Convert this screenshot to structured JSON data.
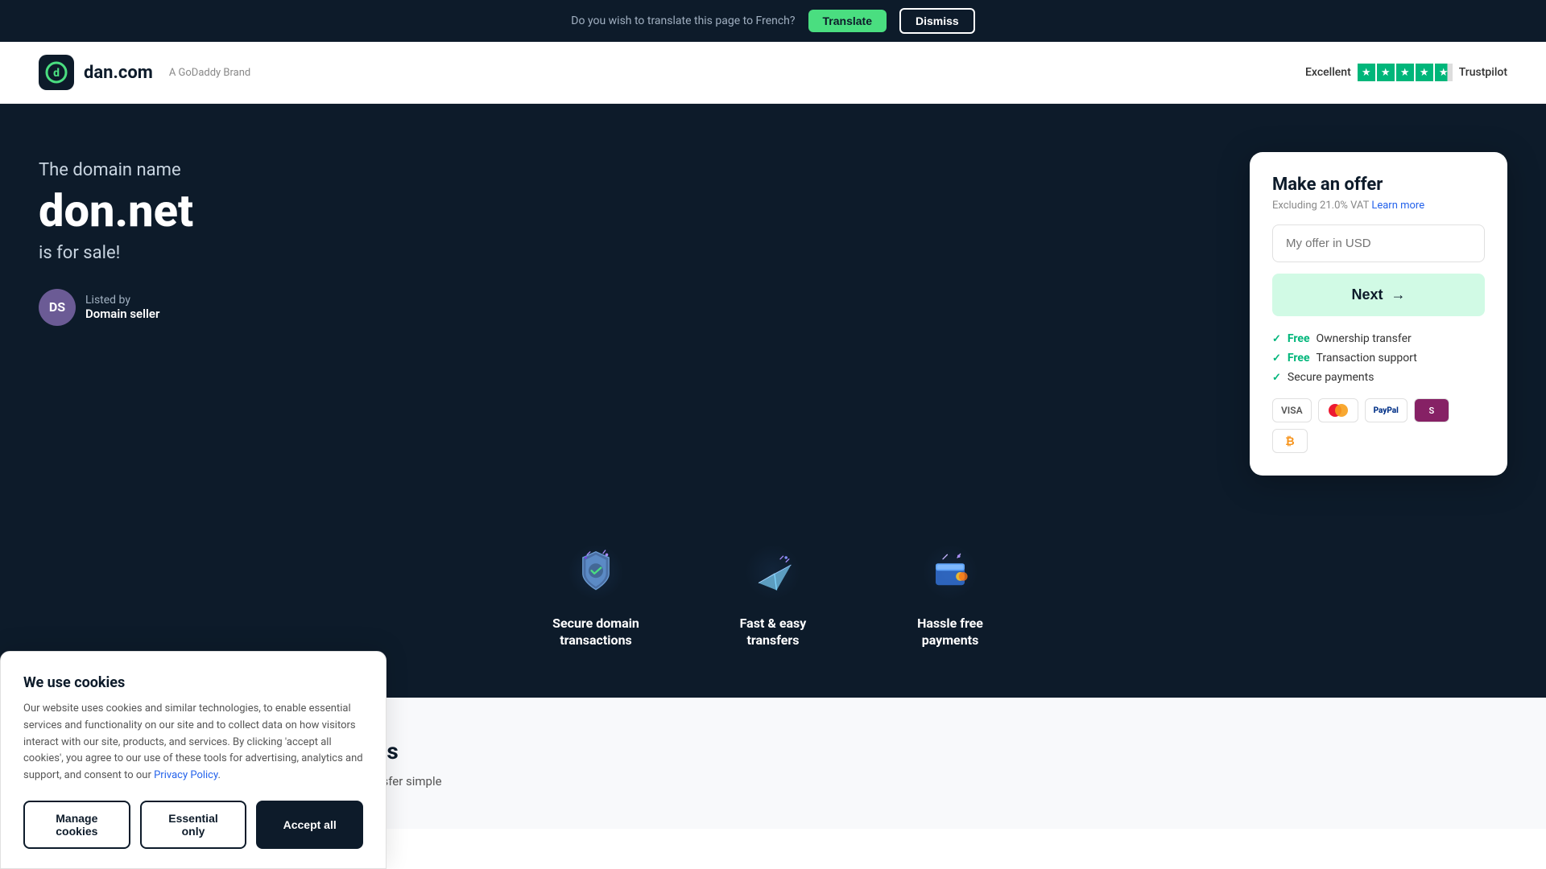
{
  "translate_bar": {
    "message": "Do you wish to translate this page to French?",
    "translate_btn": "Translate",
    "dismiss_btn": "Dismiss"
  },
  "header": {
    "logo_icon": "d",
    "logo_text": "dan.com",
    "logo_brand": "A GoDaddy Brand",
    "trustpilot_label": "Excellent",
    "trustpilot_name": "Trustpilot"
  },
  "hero": {
    "subtitle": "The domain name",
    "domain": "don.net",
    "forsale": "is for sale!",
    "listed_by_label": "Listed by",
    "listed_by_name": "Domain seller",
    "avatar_initials": "DS"
  },
  "offer_card": {
    "title": "Make an offer",
    "vat_text": "Excluding 21.0% VAT",
    "learn_more": "Learn more",
    "input_placeholder": "My offer in USD",
    "next_btn": "Next",
    "benefits": [
      {
        "label": "Ownership transfer",
        "free": true
      },
      {
        "label": "Transaction support",
        "free": true
      },
      {
        "label": "Secure payments",
        "free": false
      }
    ],
    "payment_methods": [
      "VISA",
      "MC",
      "PayPal",
      "Skrill",
      "BTC"
    ]
  },
  "features": [
    {
      "icon": "shield",
      "label": "Secure domain\ntransactions"
    },
    {
      "icon": "plane",
      "label": "Fast & easy\ntransfers"
    },
    {
      "icon": "wallet",
      "label": "Hassle free\npayments"
    }
  ],
  "body": {
    "title": "The easy way to buy domain names",
    "text": "When there is a domain name you want to buy, we make the transfer simple"
  },
  "cookie_banner": {
    "title": "We use cookies",
    "text": "Our website uses cookies and similar technologies, to enable essential services and functionality on our site and to collect data on how visitors interact with our site, products, and services. By clicking 'accept all cookies', you agree to our use of these tools for advertising, analytics and support, and consent to our",
    "privacy_link": "Privacy Policy",
    "manage_btn": "Manage cookies",
    "essential_btn": "Essential only",
    "accept_btn": "Accept all"
  }
}
